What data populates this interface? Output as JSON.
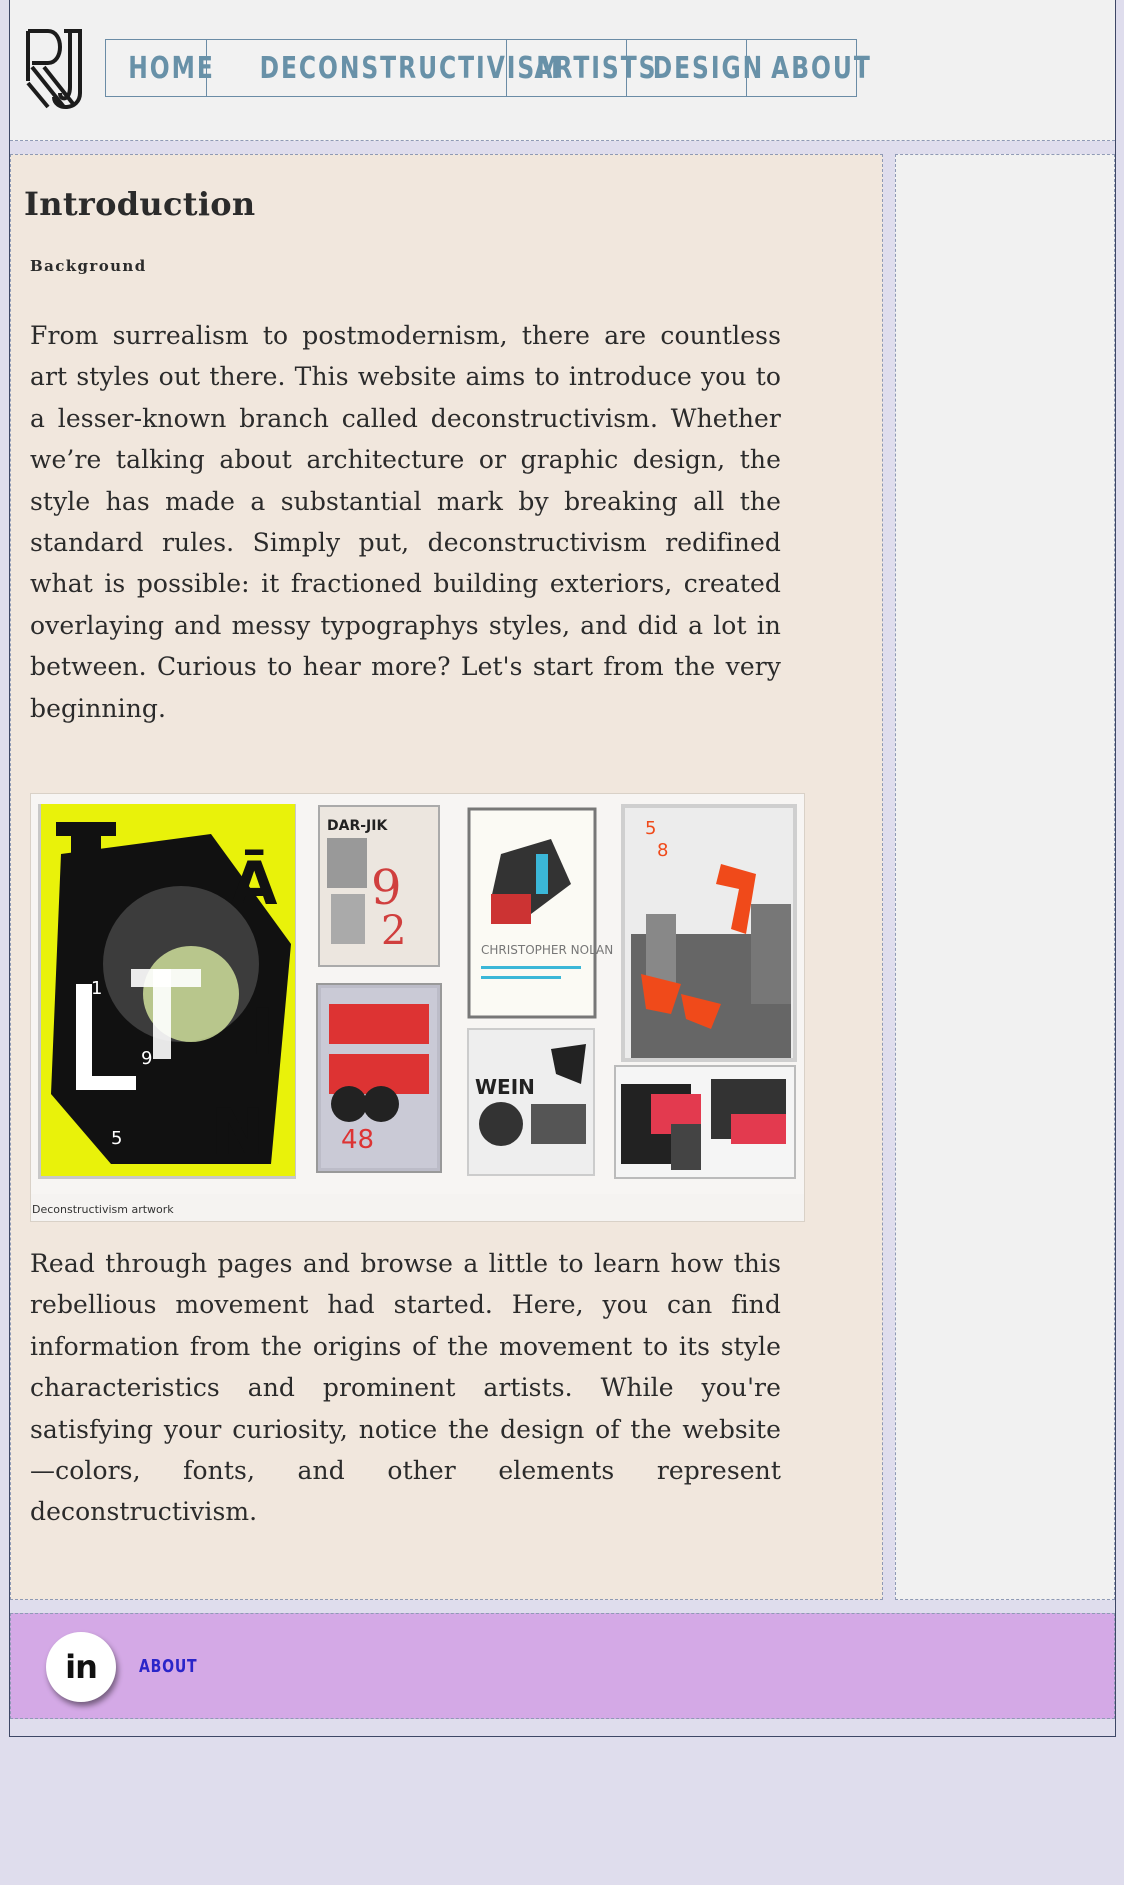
{
  "header": {
    "logo_text": "RJ",
    "nav": [
      {
        "label": "HOME"
      },
      {
        "label": "DECONSTRUCTIVISM"
      },
      {
        "label": "ARTISTS"
      },
      {
        "label": "DESIGN"
      },
      {
        "label": "ABOUT"
      }
    ]
  },
  "main": {
    "title": "Introduction",
    "section_label": "Background",
    "paragraph1": "From surrealism to postmodernism, there are countless art styles out there. This website aims to introduce you to a lesser-known branch called deconstructivism. Whether we’re talking about architecture or graphic design, the style has made a substantial mark by breaking all the standard rules. Simply put, deconstructivism redifined what is possible: it fractioned building exteriors, created overlaying and messy typographys styles, and did a lot in between. Curious to hear more? Let's start from the very beginning.",
    "figure": {
      "caption": "Deconstructivism artwork",
      "poster_texts": {
        "poster2_header": "DAR-JIK",
        "poster3_name": "CHRISTOPHER NOLAN",
        "poster5_text": "WEIN",
        "poster6_digits": "48"
      }
    },
    "paragraph2": "Read through pages and browse a little to learn how this rebellious movement had started. Here, you can find information from the origins of the movement to its style characteristics and prominent artists. While you're satisfying your curiosity, notice the design of the website—colors, fonts, and other elements represent deconstructivism."
  },
  "footer": {
    "social_icon": "in",
    "link_label": "ABOUT"
  },
  "colors": {
    "page_bg": "#dfdded",
    "header_bg": "#f1f1f1",
    "nav_text": "#6891a8",
    "main_bg": "#f1e7dd",
    "footer_bg": "#d4a9e6",
    "footer_link": "#2a25c9"
  }
}
